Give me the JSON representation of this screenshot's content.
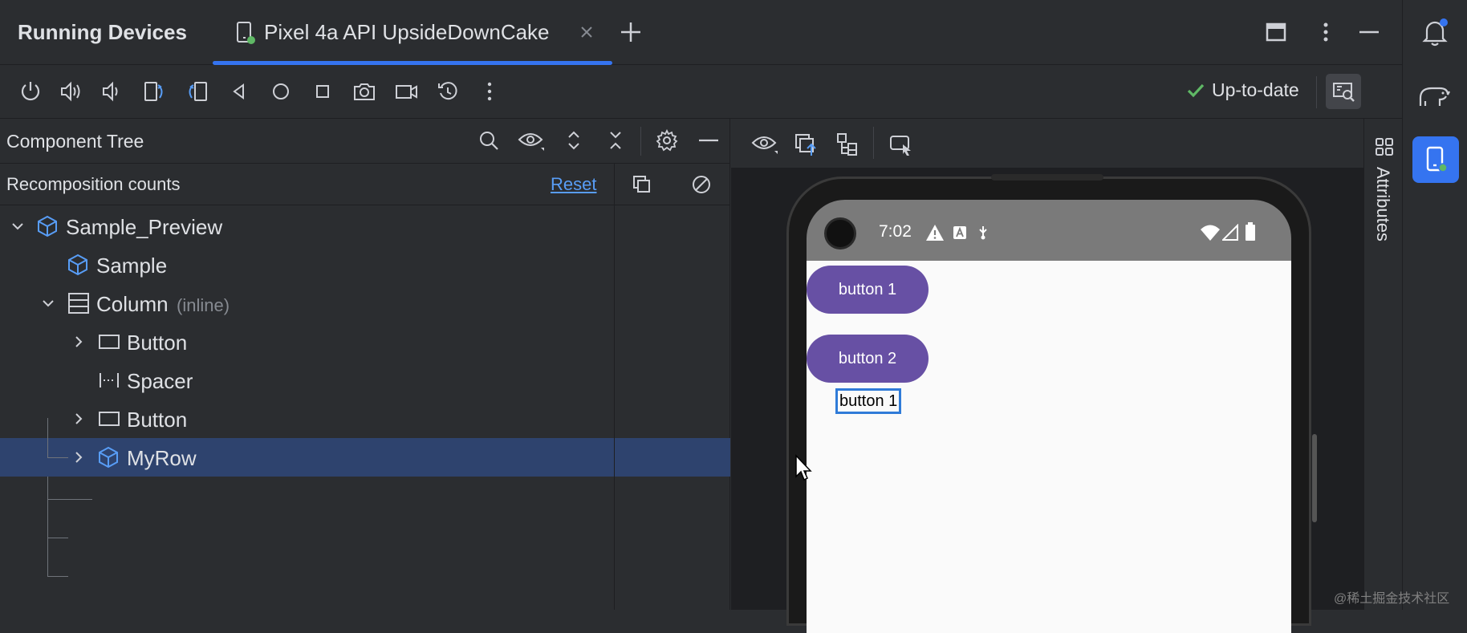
{
  "topbar": {
    "title": "Running Devices",
    "tab_label": "Pixel 4a API UpsideDownCake"
  },
  "device_toolbar": {
    "status_text": "Up-to-date"
  },
  "component_tree": {
    "header": "Component Tree",
    "recomposition_label": "Recomposition counts",
    "reset_label": "Reset",
    "nodes": [
      {
        "label": "Sample_Preview",
        "suffix": ""
      },
      {
        "label": "Sample",
        "suffix": ""
      },
      {
        "label": "Column",
        "suffix": "(inline)"
      },
      {
        "label": "Button",
        "suffix": ""
      },
      {
        "label": "Spacer",
        "suffix": ""
      },
      {
        "label": "Button",
        "suffix": ""
      },
      {
        "label": "MyRow",
        "suffix": ""
      }
    ]
  },
  "attributes_panel": {
    "label": "Attributes"
  },
  "device_screen": {
    "time": "7:02",
    "buttons": [
      "button 1",
      "button 2"
    ],
    "selected_text": "button 1"
  },
  "watermark": "@稀土掘金技术社区",
  "colors": {
    "accent": "#3574f0",
    "selection": "#2e436e",
    "app_button": "#6750a4",
    "status_ok": "#5fb865"
  }
}
